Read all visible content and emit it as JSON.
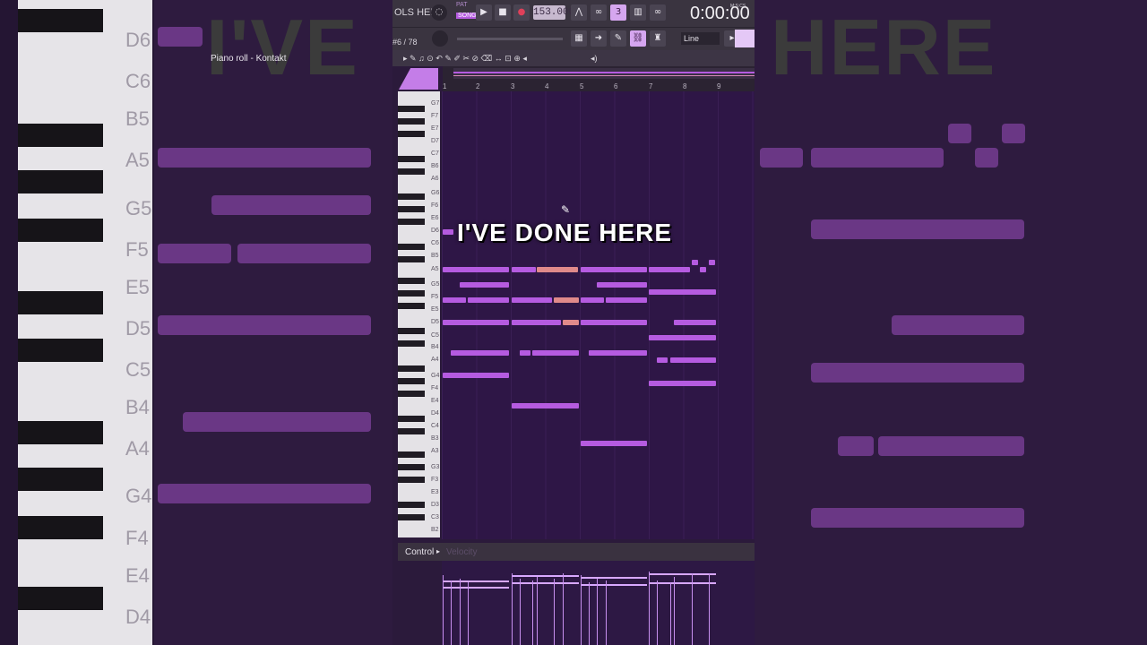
{
  "caption": "I'VE DONE HERE",
  "background_caption": {
    "left": "I'VE",
    "right": "HERE"
  },
  "background_key_labels": [
    "D6",
    "C6",
    "B5",
    "A5",
    "G5",
    "F5",
    "E5",
    "D5",
    "C5",
    "B4",
    "A4",
    "G4",
    "F4",
    "E4",
    "D4"
  ],
  "toolbar": {
    "menu": "OLS HELP",
    "pattern_label": "PAT",
    "song_label": "SONG",
    "tempo": "153.000",
    "clock": "0:00:00",
    "clock_unit": "M:S:CS",
    "counter": "#6 / 78",
    "snap": "Line"
  },
  "piano_roll": {
    "title": "Piano roll - Kontakt",
    "bars": [
      "1",
      "2",
      "3",
      "4",
      "5",
      "6",
      "7",
      "8",
      "9"
    ],
    "key_labels": [
      "G7",
      "F7",
      "E7",
      "D7",
      "C7",
      "B6",
      "A6",
      "G6",
      "F6",
      "E6",
      "D6",
      "C6",
      "B5",
      "A5",
      "G5",
      "F5",
      "E5",
      "D5",
      "C5",
      "B4",
      "A4",
      "G4",
      "F4",
      "E4",
      "D4",
      "C4",
      "B3",
      "A3",
      "G3",
      "F3",
      "E3",
      "D3",
      "C3",
      "B2"
    ]
  },
  "event_editor": {
    "control_label": "Control",
    "parameter": "Velocity"
  },
  "colors": {
    "note": "#b55be0",
    "selected_note": "#e08a8a",
    "grid": "#2e1646"
  }
}
